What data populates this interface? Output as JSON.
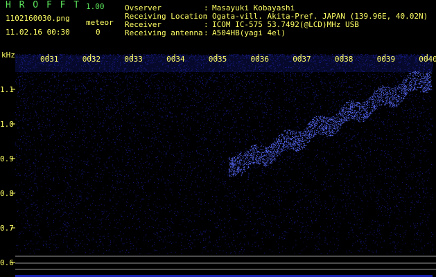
{
  "app": {
    "name": "H R O F F T",
    "version": "1.00"
  },
  "file": {
    "name": "1102160030.png",
    "datetime": "11.02.16 00:30"
  },
  "meteor": {
    "label": "meteor",
    "count": "0"
  },
  "station": [
    {
      "key": "Ovserver",
      "sep": ":",
      "value": "Masayuki Kobayashi"
    },
    {
      "key": "Receiving Location",
      "sep": ":",
      "value": "Ogata-vill. Akita-Pref. JAPAN (139.96E, 40.02N)"
    },
    {
      "key": "Receiver",
      "sep": ":",
      "value": "ICOM IC-575 53.7492(@LCD)MHz USB"
    },
    {
      "key": "Receiving antenna",
      "sep": ":",
      "value": "A504HB(yagi 4el)"
    }
  ],
  "spectrogram": {
    "y_unit": "kHz",
    "y_ticks": [
      "1.1",
      "1.0",
      "0.9",
      "0.8",
      "0.7",
      "0.6"
    ],
    "y_values": [
      1.1,
      1.0,
      0.9,
      0.8,
      0.7,
      0.6
    ],
    "x_ticks": [
      "0031",
      "0032",
      "0033",
      "0034",
      "0035",
      "0036",
      "0037",
      "0038",
      "0039",
      "0040"
    ],
    "colors": {
      "noise": "#1a24b0",
      "signal": "#5a6cff",
      "tick": "#ffff66",
      "line": "#9a9a9a"
    }
  }
}
